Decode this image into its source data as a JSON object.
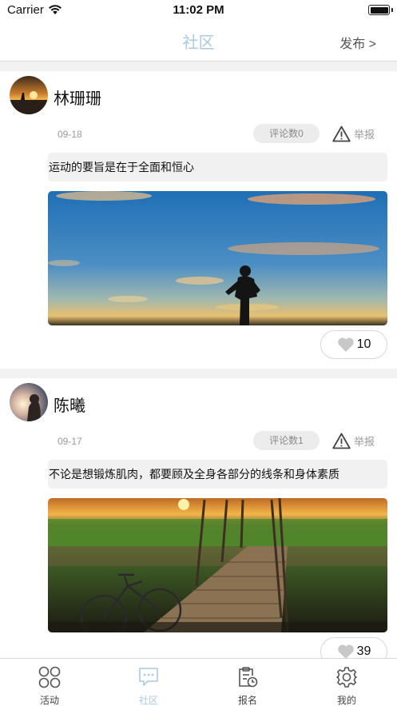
{
  "status_bar": {
    "carrier": "Carrier",
    "time": "11:02 PM"
  },
  "nav": {
    "title": "社区",
    "publish_label": "发布 >"
  },
  "posts": [
    {
      "author": "林珊珊",
      "date": "09-18",
      "comment_count": "评论数0",
      "report_label": "举报",
      "text": "运动的要旨是在于全面和恒心",
      "likes": "10",
      "image": "runner-silhouette-at-sunset"
    },
    {
      "author": "陈曦",
      "date": "09-17",
      "comment_count": "评论数1",
      "report_label": "举报",
      "text": "不论是想锻炼肌肉，都要顾及全身各部分的线条和身体素质",
      "likes": "39",
      "image": "bicycle-on-wooden-bridge-at-sunset"
    }
  ],
  "tab_bar": {
    "items": [
      {
        "label": "活动",
        "icon": "grid-circles-icon"
      },
      {
        "label": "社区",
        "icon": "chat-bubble-icon"
      },
      {
        "label": "报名",
        "icon": "clipboard-clock-icon"
      },
      {
        "label": "我的",
        "icon": "gear-icon"
      }
    ]
  },
  "colors": {
    "accent": "#a9c9e6",
    "background": "#f2f2f2"
  }
}
